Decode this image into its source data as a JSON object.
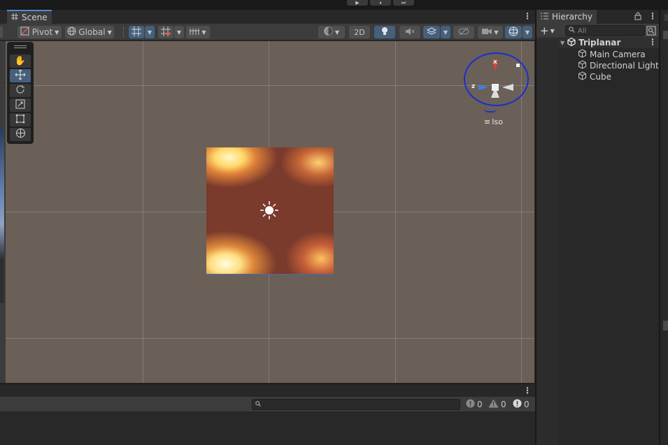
{
  "top_bar": {
    "play_icon": "▶",
    "pause_icon": "⏸",
    "step_icon": "⏭"
  },
  "scene": {
    "tab_label": "Scene",
    "toolbar": {
      "pivot_label": "Pivot",
      "global_label": "Global",
      "mode_2d_label": "2D"
    },
    "gizmo": {
      "x_label": "x",
      "z_label": "z",
      "projection_label": "Iso"
    },
    "tools": [
      "hand-tool",
      "move-tool",
      "rotate-tool",
      "scale-tool",
      "rect-tool",
      "transform-tool"
    ]
  },
  "console": {
    "error_count": "0",
    "warning_count": "0",
    "info_count": "0"
  },
  "hierarchy": {
    "tab_label": "Hierarchy",
    "search_placeholder": "All",
    "scene_name": "Triplanar",
    "items": [
      {
        "label": "Main Camera"
      },
      {
        "label": "Directional Light"
      },
      {
        "label": "Cube"
      }
    ]
  },
  "colors": {
    "accent": "#46607c",
    "panel": "#282828",
    "toolbar": "#3c3c3c",
    "viewport": "#6a6058",
    "annotation": "#1a2fd0"
  }
}
